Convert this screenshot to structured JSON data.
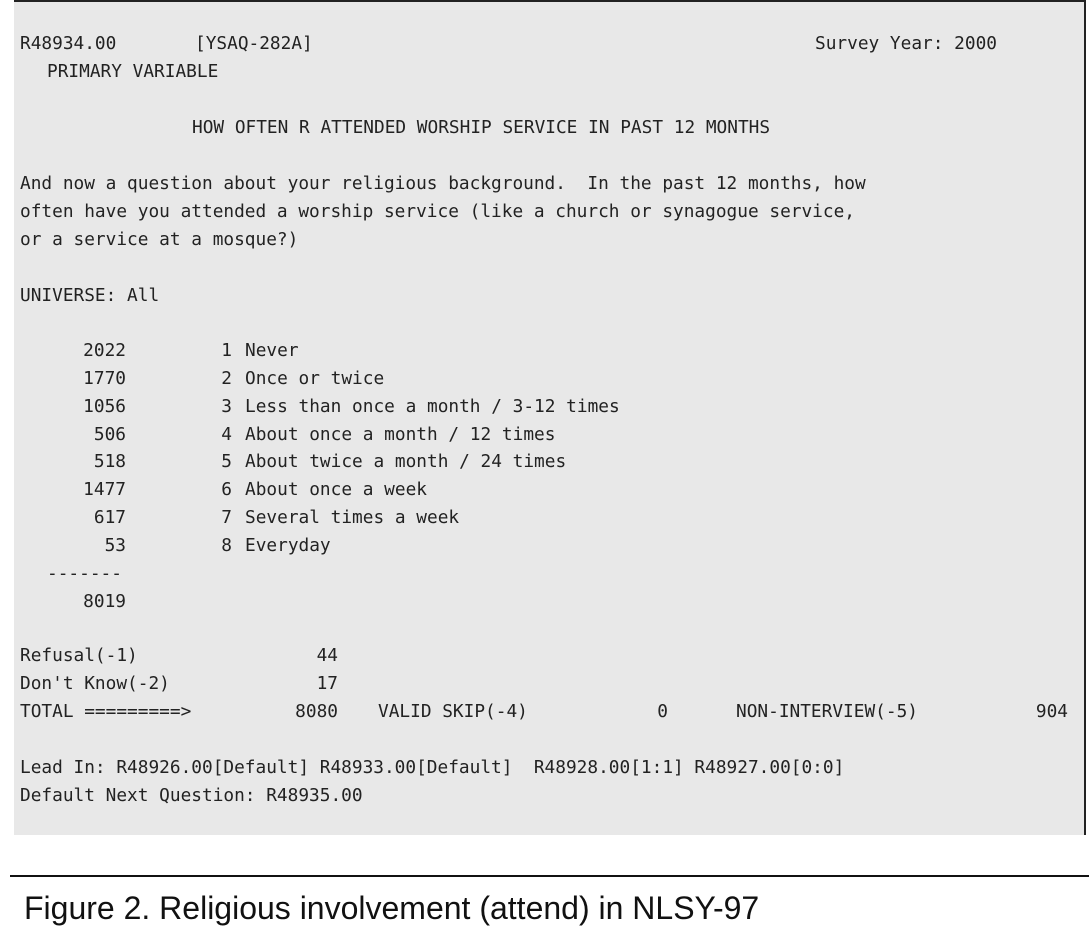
{
  "header": {
    "variable_id": "R48934.00",
    "question_code": "[YSAQ-282A]",
    "survey_year": "Survey Year: 2000",
    "variable_type": "PRIMARY VARIABLE"
  },
  "title": "HOW OFTEN R ATTENDED WORSHIP SERVICE IN PAST 12 MONTHS",
  "question_text": [
    "And now a question about your religious background.  In the past 12 months, how",
    "often have you attended a worship service (like a church or synagogue service,",
    "or a service at a mosque?)"
  ],
  "universe": "UNIVERSE: All",
  "responses": [
    {
      "count": "2022",
      "code": "1",
      "label": "Never"
    },
    {
      "count": "1770",
      "code": "2",
      "label": "Once or twice"
    },
    {
      "count": "1056",
      "code": "3",
      "label": "Less than once a month / 3-12 times"
    },
    {
      "count": "506",
      "code": "4",
      "label": "About once a month / 12 times"
    },
    {
      "count": "518",
      "code": "5",
      "label": "About twice a month / 24 times"
    },
    {
      "count": "1477",
      "code": "6",
      "label": "About once a week"
    },
    {
      "count": "617",
      "code": "7",
      "label": "Several times a week"
    },
    {
      "count": "53",
      "code": "8",
      "label": "Everyday"
    }
  ],
  "separator": "-------",
  "subtotal": "8019",
  "missing": {
    "refusal_label": "Refusal(-1)",
    "refusal_count": "44",
    "dont_know_label": "Don't Know(-2)",
    "dont_know_count": "17",
    "total_label": "TOTAL =========>",
    "total_count": "8080",
    "valid_skip_label": "VALID SKIP(-4)",
    "valid_skip_count": "0",
    "non_interview_label": "NON-INTERVIEW(-5)",
    "non_interview_count": "904"
  },
  "lead_in": "Lead In: R48926.00[Default] R48933.00[Default]  R48928.00[1:1] R48927.00[0:0]",
  "default_next": "Default Next Question: R48935.00",
  "caption": "Figure 2. Religious involvement (attend) in NLSY-97"
}
